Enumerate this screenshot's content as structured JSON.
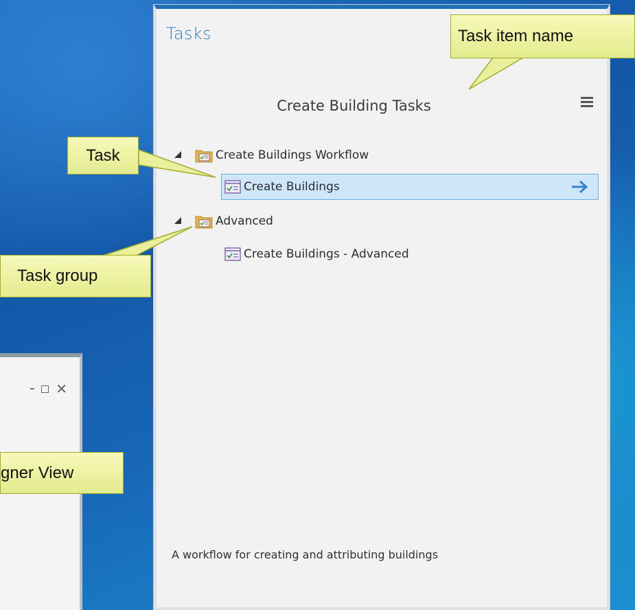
{
  "tasks_pane": {
    "title": "Tasks",
    "task_item_name": "Create Building Tasks",
    "menu_icon": "hamburger-menu-icon",
    "description": "A workflow for creating and attributing buildings",
    "groups": [
      {
        "label": "Create Buildings Workflow",
        "expanded": true,
        "tasks": [
          {
            "label": "Create Buildings",
            "selected": true
          }
        ]
      },
      {
        "label": "Advanced",
        "expanded": true,
        "tasks": [
          {
            "label": "Create Buildings - Advanced",
            "selected": false
          }
        ]
      }
    ]
  },
  "designer_window": {
    "controls": [
      "maximize-icon",
      "close-icon"
    ]
  },
  "callouts": {
    "task_item_name": "Task item name",
    "task": "Task",
    "task_group": "Task group",
    "designer_view": "gner View"
  },
  "colors": {
    "accent": "#2b79c2",
    "selection_fill": "#cfe6f8",
    "selection_border": "#6aaee0",
    "callout_fill": "#eef3a4",
    "callout_border": "#a0ac2a"
  }
}
